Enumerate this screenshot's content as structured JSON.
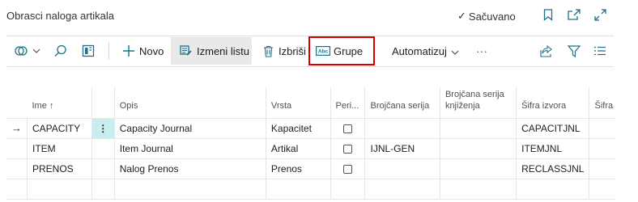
{
  "header": {
    "title": "Obrasci naloga artikala",
    "saved_label": "Sačuvano",
    "icons": [
      "check-icon",
      "bookmark-icon",
      "open-in-new-icon",
      "expand-icon"
    ]
  },
  "toolbar": {
    "new_label": "Novo",
    "edit_list_label": "Izmeni listu",
    "delete_label": "Izbriši",
    "groups_label": "Grupe",
    "automate_label": "Automatizuj",
    "more_label": "···"
  },
  "table": {
    "columns": [
      "Ime",
      "Opis",
      "Vrsta",
      "Peri...",
      "Brojčana serija",
      "Brojčana serija knjiženja",
      "Šifra izvora",
      "Šifra"
    ],
    "sort_indicator": "↑",
    "rows": [
      {
        "name": "CAPACITY",
        "description": "Capacity Journal",
        "type": "Kapacitet",
        "periodic": false,
        "no_series": "",
        "posting_no_series": "",
        "source_code": "CAPACITJNL"
      },
      {
        "name": "ITEM",
        "description": "Item Journal",
        "type": "Artikal",
        "periodic": false,
        "no_series": "IJNL-GEN",
        "posting_no_series": "",
        "source_code": "ITEMJNL"
      },
      {
        "name": "PRENOS",
        "description": "Nalog Prenos",
        "type": "Prenos",
        "periodic": false,
        "no_series": "",
        "posting_no_series": "",
        "source_code": "RECLASSJNL"
      }
    ]
  },
  "colors": {
    "accent": "#d40000",
    "selection": "#c9eef2",
    "brand_icon": "#1e6f8a"
  }
}
